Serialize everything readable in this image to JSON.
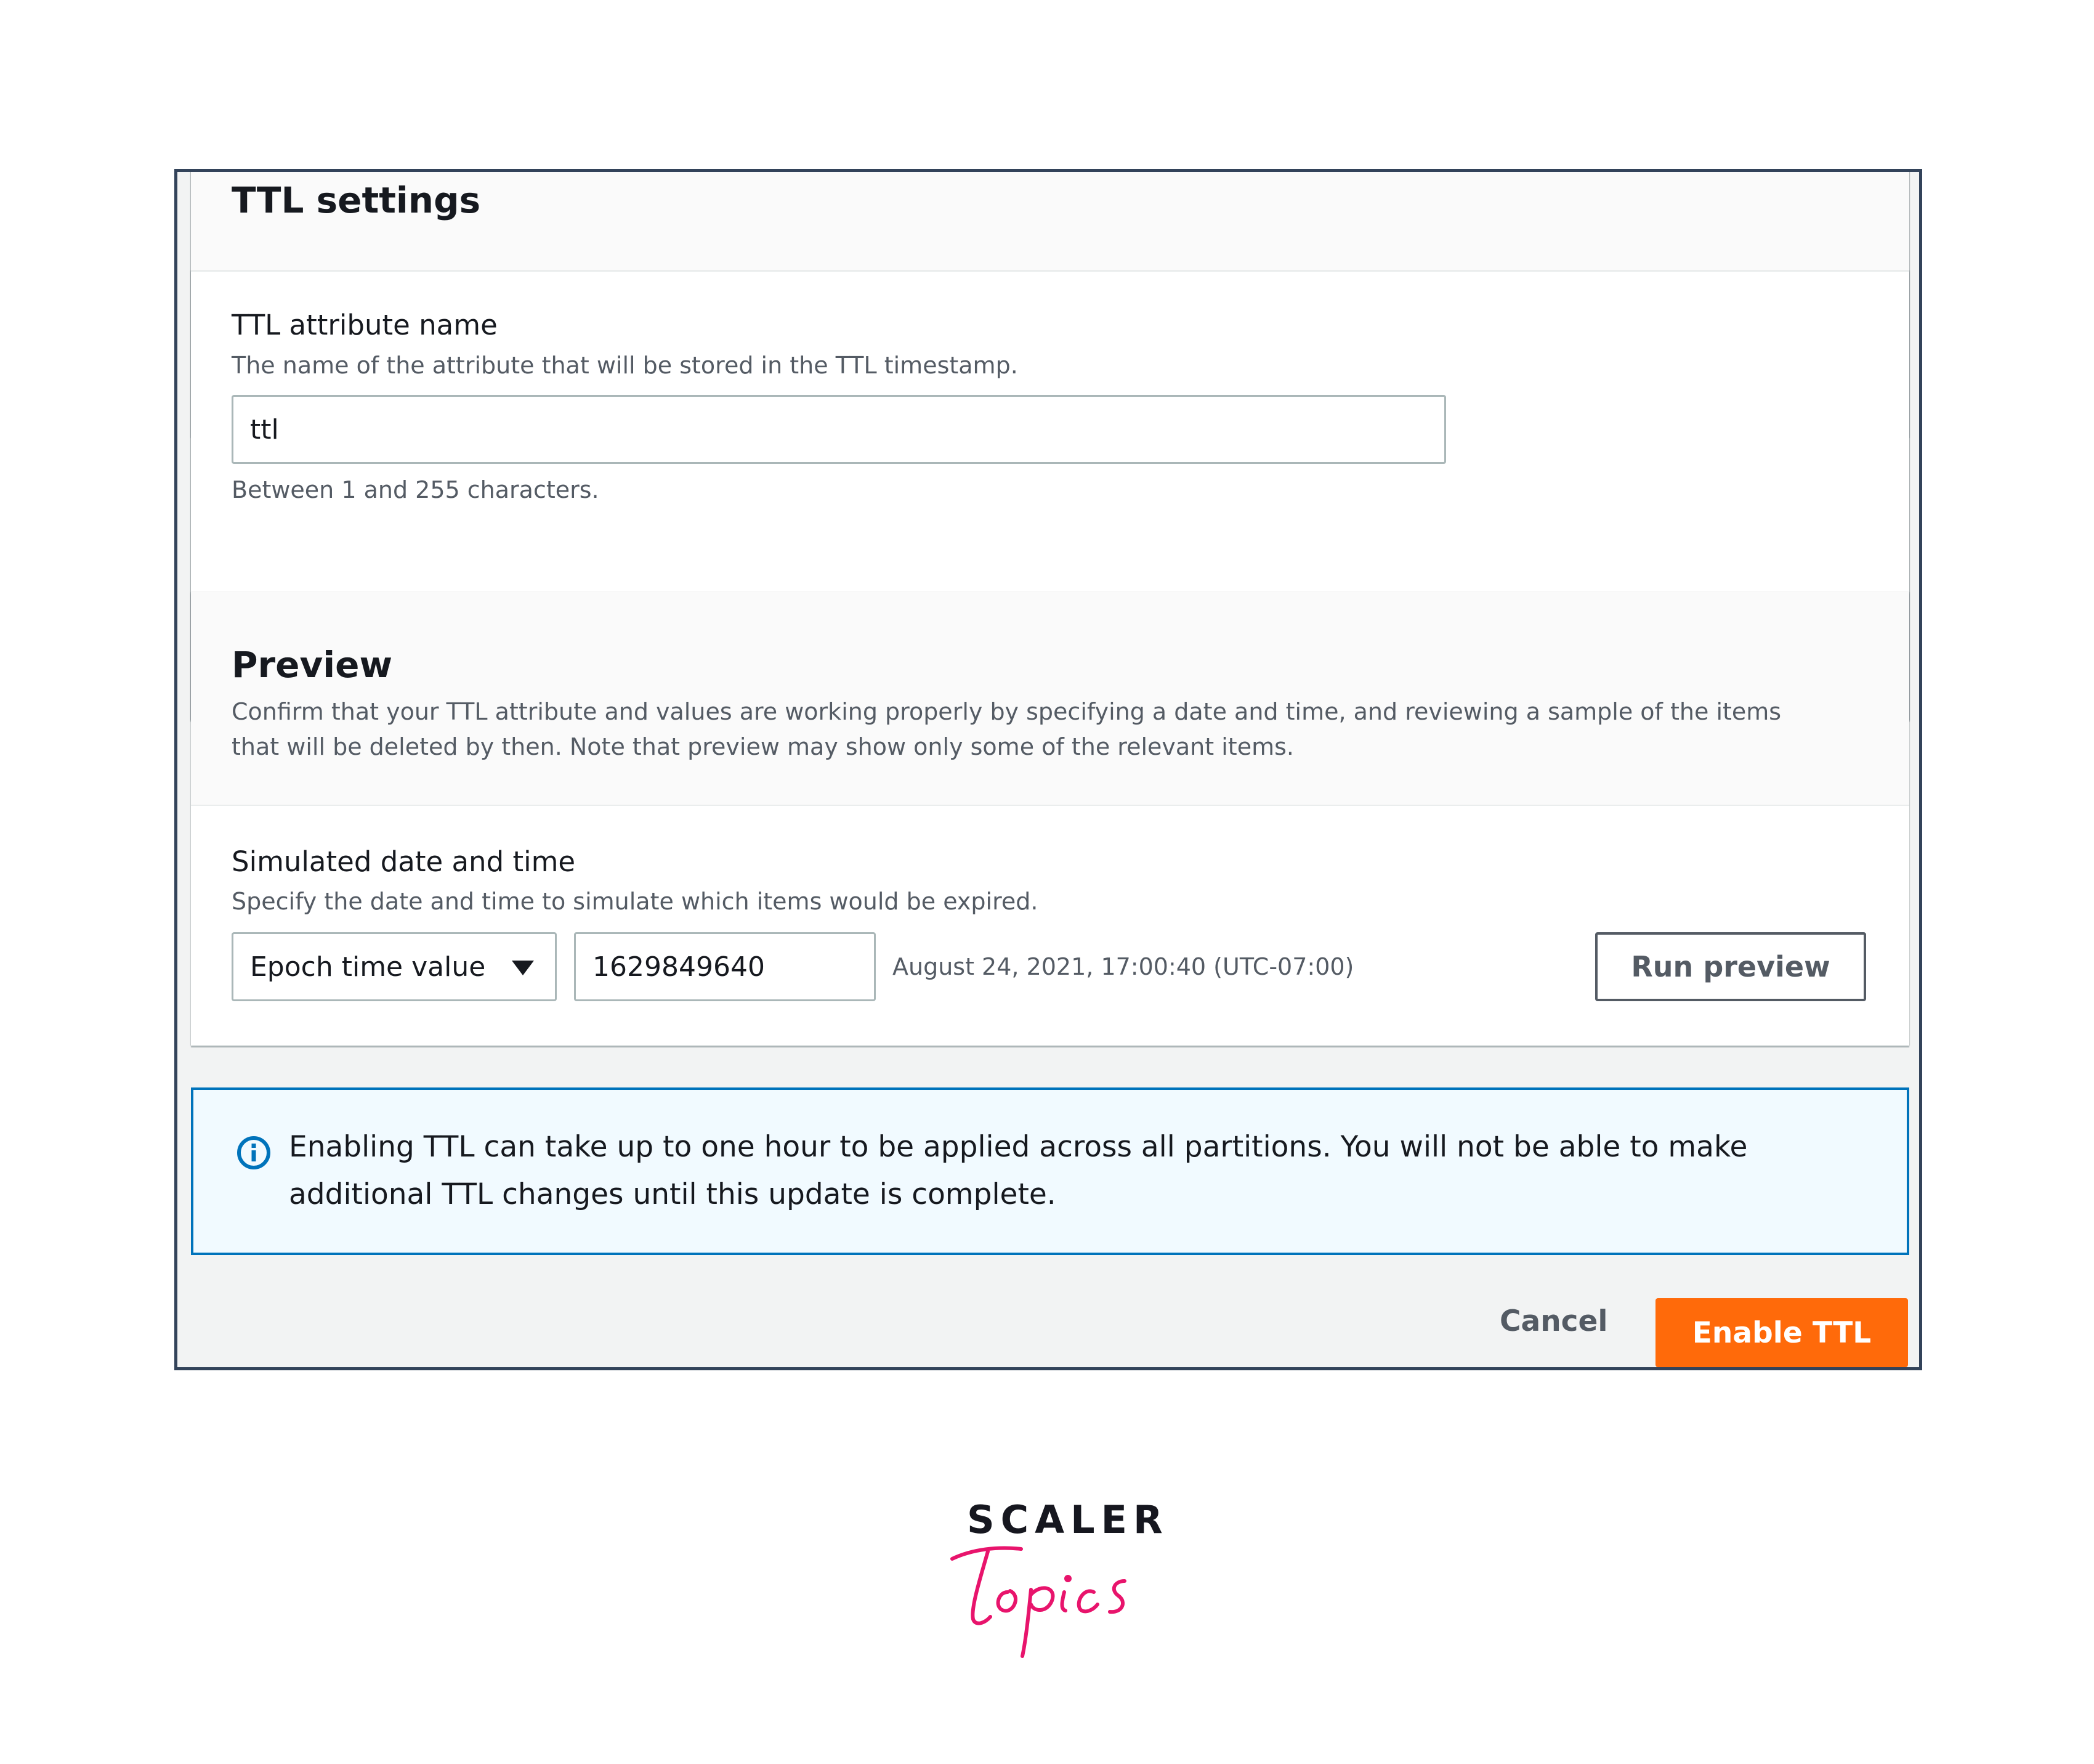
{
  "ttl_settings": {
    "title": "TTL settings",
    "attribute_label": "TTL attribute name",
    "attribute_description": "The name of the attribute that will be stored in the TTL timestamp.",
    "attribute_value": "ttl",
    "attribute_constraint": "Between 1 and 255 characters."
  },
  "preview": {
    "title": "Preview",
    "description": "Confirm that your TTL attribute and values are working properly by specifying a date and time, and reviewing a sample of the items that will be deleted by then. Note that preview may show only some of the relevant items.",
    "simulated_label": "Simulated date and time",
    "simulated_description": "Specify the date and time to simulate which items would be expired.",
    "format_select": "Epoch time value",
    "epoch_value": "1629849640",
    "converted_date": "August 24, 2021, 17:00:40 (UTC-07:00)",
    "run_button": "Run preview"
  },
  "alert": {
    "icon": "info-icon",
    "message": "Enabling TTL can take up to one hour to be applied across all partitions. You will not be able to make additional TTL changes until this update is complete."
  },
  "footer": {
    "cancel_label": "Cancel",
    "enable_label": "Enable TTL"
  },
  "logo": {
    "word1": "SCALER",
    "word2": "Topics"
  },
  "colors": {
    "primary_button": "#ff6a0a",
    "info_border": "#0073bb",
    "info_background": "#f1faff",
    "logo_pink": "#e8146c",
    "frame_border": "#33435a"
  }
}
